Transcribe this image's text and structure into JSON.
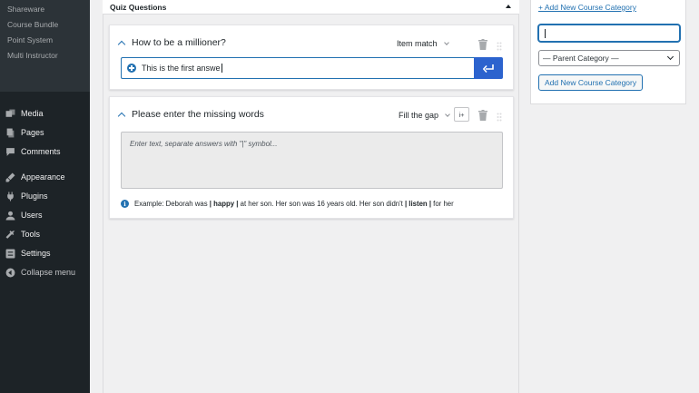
{
  "sidebar": {
    "submenu": [
      "Shareware",
      "Course Bundle",
      "Point System",
      "Multi Instructor"
    ],
    "menu": [
      {
        "label": "Media",
        "icon": "media-icon"
      },
      {
        "label": "Pages",
        "icon": "pages-icon"
      },
      {
        "label": "Comments",
        "icon": "comments-icon"
      },
      {
        "label": "Appearance",
        "icon": "appearance-icon"
      },
      {
        "label": "Plugins",
        "icon": "plugins-icon"
      },
      {
        "label": "Users",
        "icon": "users-icon"
      },
      {
        "label": "Tools",
        "icon": "tools-icon"
      },
      {
        "label": "Settings",
        "icon": "settings-icon"
      }
    ],
    "collapse": "Collapse menu"
  },
  "quiz": {
    "title": "Quiz Questions",
    "questions": [
      {
        "title": "How to be a millioner?",
        "type": "Item match",
        "answer_value": "This is the first answe"
      },
      {
        "title": "Please enter the missing words",
        "type": "Fill the gap",
        "hint_label": "i+",
        "placeholder": "Enter text, separate answers with \"|\" symbol...",
        "example": {
          "prefix": "Example: Deborah was ",
          "bold1": "| happy |",
          "middle": " at her son. Her son was 16 years old. Her son didn't ",
          "bold2": "| listen |",
          "suffix": " for her"
        }
      }
    ]
  },
  "category_panel": {
    "add_link": "+ Add New Course Category",
    "input_value": "",
    "parent_select": "— Parent Category —",
    "add_button": "Add New Course Category"
  },
  "colors": {
    "accent": "#2271b1",
    "enter_button": "#2c63ce",
    "sidebar_bg": "#1d2327"
  }
}
